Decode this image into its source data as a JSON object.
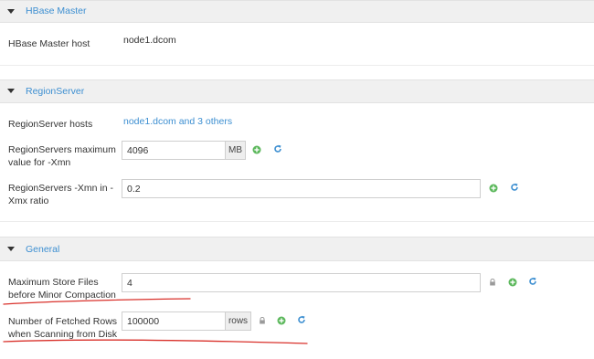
{
  "hbase_master": {
    "title": "HBase Master",
    "host_label": "HBase Master host",
    "host_value": "node1.dcom"
  },
  "region_server": {
    "title": "RegionServer",
    "hosts_label": "RegionServer hosts",
    "hosts_link": "node1.dcom and 3 others",
    "xmn_label_line1": "RegionServers maximum",
    "xmn_label_line2": "value for -Xmn",
    "xmn_value": "4096",
    "xmn_unit": "MB",
    "ratio_label_line1": "RegionServers -Xmn in -",
    "ratio_label_line2": "Xmx ratio",
    "ratio_value": "0.2"
  },
  "general": {
    "title": "General",
    "store_files_label_line1": "Maximum Store Files",
    "store_files_label_line2": "before Minor Compaction",
    "store_files_value": "4",
    "fetched_rows_label_line1": "Number of Fetched Rows",
    "fetched_rows_label_line2": "when Scanning from Disk",
    "fetched_rows_value": "100000",
    "fetched_rows_unit": "rows"
  },
  "colors": {
    "link": "#3d8fd1",
    "add_icon": "#5cb85c",
    "undo_icon": "#3d8fd1",
    "annotation": "#d9312b"
  },
  "icons": [
    "caret-down-icon",
    "lock-icon",
    "plus-circle-icon",
    "undo-icon"
  ]
}
